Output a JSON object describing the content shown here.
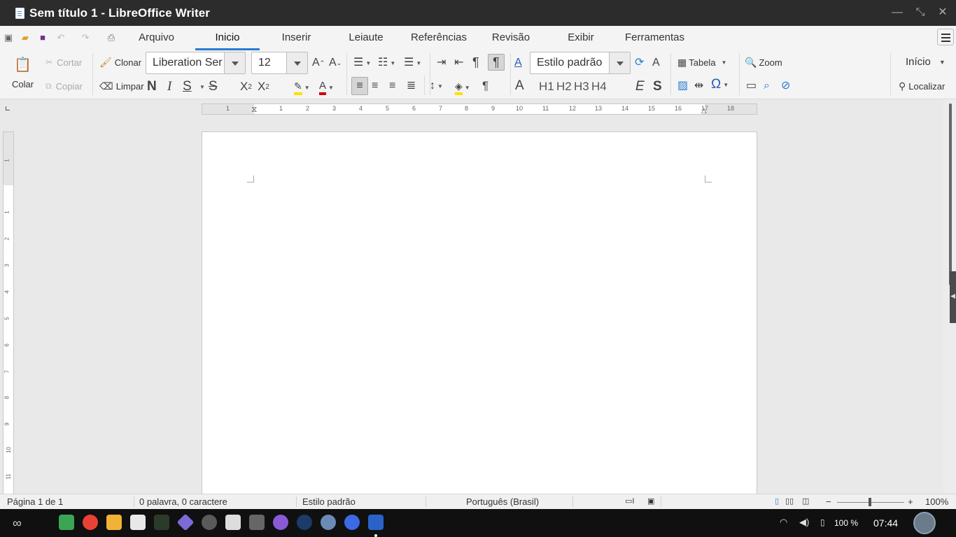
{
  "window": {
    "title": "Sem título 1 - LibreOffice Writer"
  },
  "menu_tabs": [
    {
      "label": "Arquivo"
    },
    {
      "label": "Inicio",
      "active": true
    },
    {
      "label": "Inserir"
    },
    {
      "label": "Leiaute"
    },
    {
      "label": "Referências"
    },
    {
      "label": "Revisão"
    },
    {
      "label": "Exibir"
    },
    {
      "label": "Ferramentas"
    }
  ],
  "ribbon": {
    "paste_label": "Colar",
    "cut_label": "Cortar",
    "copy_label": "Copiar",
    "clone_label": "Clonar",
    "clear_label": "Limpar",
    "font_name": "Liberation Ser",
    "font_size": "12",
    "bold_glyph": "N",
    "italic_glyph": "I",
    "underline_glyph": "S",
    "strike_glyph": "S",
    "paragraph_style": "Estilo padrão",
    "table_label": "Tabela",
    "zoom_label": "Zoom",
    "start_label": "Início",
    "find_label": "Localizar",
    "headings": [
      "H1",
      "H2",
      "H3",
      "H4"
    ],
    "emphasis_glyph": "E",
    "strong_glyph": "S"
  },
  "ruler": {
    "h_numbers": [
      "1",
      "1",
      "2",
      "3",
      "4",
      "5",
      "6",
      "7",
      "8",
      "9",
      "10",
      "11",
      "12",
      "13",
      "14",
      "15",
      "16",
      "17",
      "18"
    ],
    "v_numbers": [
      "1",
      "1",
      "2",
      "3",
      "4",
      "5",
      "6",
      "7",
      "8",
      "9",
      "10",
      "11"
    ]
  },
  "statusbar": {
    "page": "Página 1 de 1",
    "words": "0 palavra, 0 caractere",
    "style": "Estilo padrão",
    "language": "Português (Brasil)",
    "zoom": "100%"
  },
  "taskbar": {
    "battery": "100 %",
    "clock": "07:44"
  },
  "colors": {
    "accent": "#2a7bd0",
    "titlebar": "#2c2c2c",
    "taskbar": "#101010",
    "highlight": "#ffe000",
    "font_color": "#d00000"
  }
}
